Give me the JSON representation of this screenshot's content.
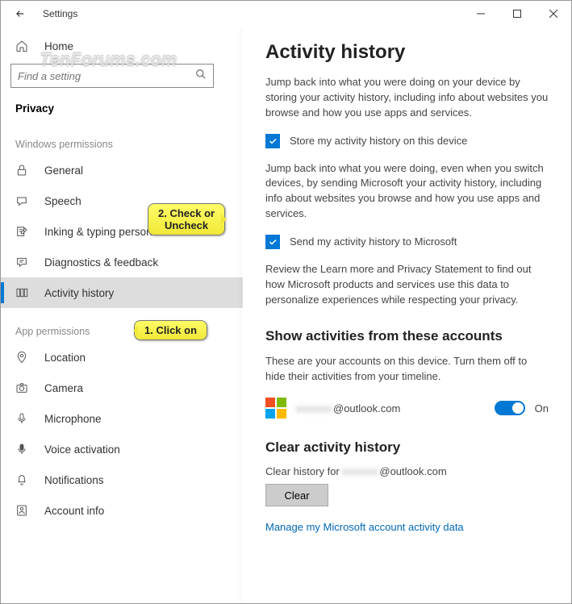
{
  "window": {
    "title": "Settings"
  },
  "watermark": "TenForums.com",
  "sidebar": {
    "home": "Home",
    "search_placeholder": "Find a setting",
    "current_page": "Privacy",
    "section1_header": "Windows permissions",
    "items1": [
      {
        "icon": "lock-icon",
        "label": "General"
      },
      {
        "icon": "speech-icon",
        "label": "Speech"
      },
      {
        "icon": "inking-icon",
        "label": "Inking & typing personalization"
      },
      {
        "icon": "feedback-icon",
        "label": "Diagnostics & feedback"
      },
      {
        "icon": "activity-icon",
        "label": "Activity history"
      }
    ],
    "section2_header": "App permissions",
    "items2": [
      {
        "icon": "location-icon",
        "label": "Location"
      },
      {
        "icon": "camera-icon",
        "label": "Camera"
      },
      {
        "icon": "microphone-icon",
        "label": "Microphone"
      },
      {
        "icon": "voice-icon",
        "label": "Voice activation"
      },
      {
        "icon": "notifications-icon",
        "label": "Notifications"
      },
      {
        "icon": "account-icon",
        "label": "Account info"
      }
    ]
  },
  "content": {
    "h1": "Activity history",
    "p1": "Jump back into what you were doing on your device by storing your activity history, including info about websites you browse and how you use apps and services.",
    "chk1": "Store my activity history on this device",
    "p2": "Jump back into what you were doing, even when you switch devices, by sending Microsoft your activity history, including info about websites you browse and how you use apps and services.",
    "chk2": "Send my activity history to Microsoft",
    "p3": "Review the Learn more and Privacy Statement to find out how Microsoft products and services use this data to personalize experiences while respecting your privacy.",
    "h2a": "Show activities from these accounts",
    "p4": "These are your accounts on this device. Turn them off to hide their activities from your timeline.",
    "account_email_suffix": "@outlook.com",
    "toggle_state": "On",
    "h2b": "Clear activity history",
    "clear_label_prefix": "Clear history for ",
    "clear_label_suffix": "@outlook.com",
    "clear_button": "Clear",
    "link": "Manage my Microsoft account activity data"
  },
  "callouts": {
    "c1": "1. Click on",
    "c2_line1": "2. Check or",
    "c2_line2": "Uncheck"
  }
}
